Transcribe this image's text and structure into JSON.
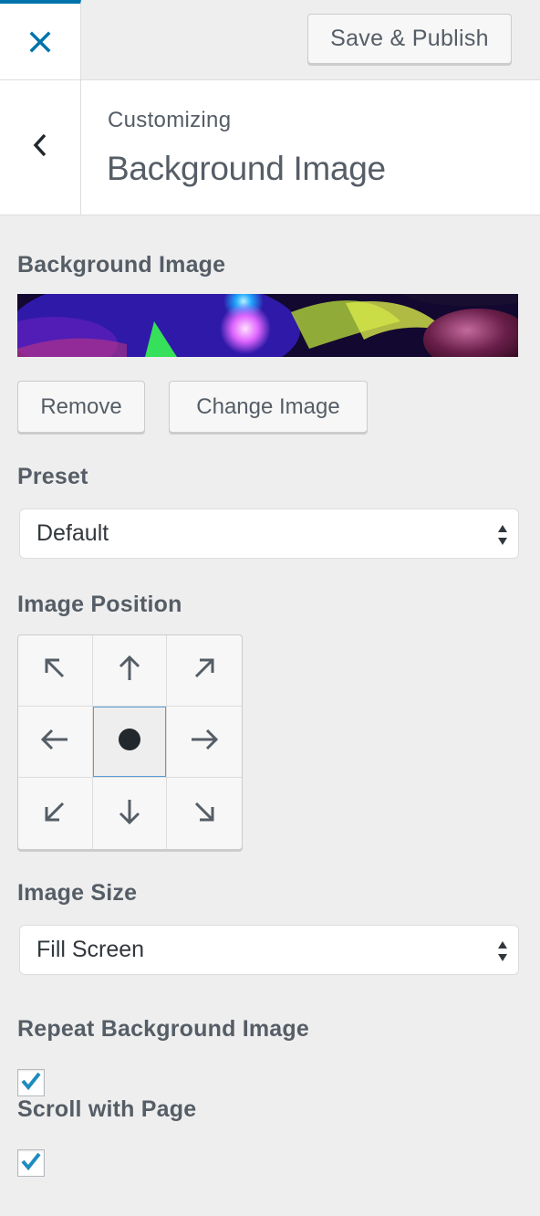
{
  "header": {
    "close_icon": "close-icon",
    "publish_label": "Save & Publish"
  },
  "section": {
    "back_icon": "chevron-left-icon",
    "subtitle": "Customizing",
    "title": "Background Image"
  },
  "background_image": {
    "label": "Background Image",
    "remove_label": "Remove",
    "change_label": "Change Image"
  },
  "preset": {
    "label": "Preset",
    "value": "Default"
  },
  "image_position": {
    "label": "Image Position",
    "cells": [
      "arrow-up-left-icon",
      "arrow-up-icon",
      "arrow-up-right-icon",
      "arrow-left-icon",
      "center-dot-icon",
      "arrow-right-icon",
      "arrow-down-left-icon",
      "arrow-down-icon",
      "arrow-down-right-icon"
    ],
    "selected": "center"
  },
  "image_size": {
    "label": "Image Size",
    "value": "Fill Screen"
  },
  "repeat": {
    "label": "Repeat Background Image",
    "checked": true
  },
  "scroll": {
    "label": "Scroll with Page",
    "checked": true
  },
  "colors": {
    "accent": "#0073aa",
    "text": "#555d66",
    "panel": "#eeeeee",
    "focus": "#5b9dd9"
  }
}
